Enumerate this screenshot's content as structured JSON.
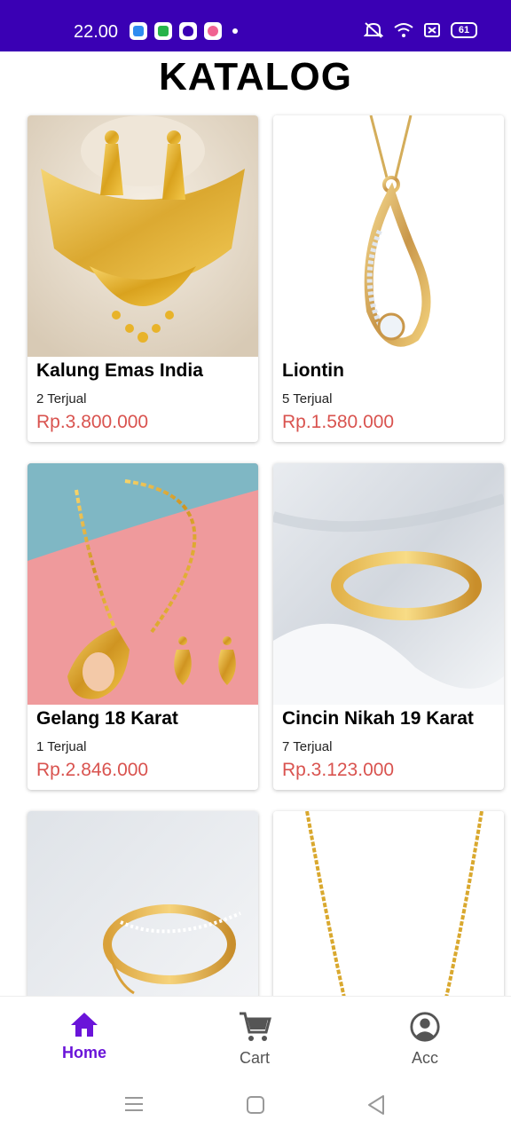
{
  "status_bar": {
    "time": "22.00",
    "battery": "61"
  },
  "page": {
    "title": "KATALOG"
  },
  "products": [
    {
      "name": "Kalung Emas India",
      "sold": "2 Terjual",
      "price": "Rp.3.800.000"
    },
    {
      "name": "Liontin",
      "sold": "5 Terjual",
      "price": "Rp.1.580.000"
    },
    {
      "name": "Gelang 18 Karat",
      "sold": "1 Terjual",
      "price": "Rp.2.846.000"
    },
    {
      "name": "Cincin Nikah 19 Karat",
      "sold": "7 Terjual",
      "price": "Rp.3.123.000"
    }
  ],
  "bottom_nav": {
    "home": "Home",
    "cart": "Cart",
    "acc": "Acc"
  },
  "colors": {
    "status_bar": "#3a00b4",
    "accent": "#6a14d9",
    "price": "#d9534f"
  },
  "icons": [
    "home-icon",
    "cart-icon",
    "account-icon",
    "menu-icon",
    "square-icon",
    "back-icon"
  ]
}
